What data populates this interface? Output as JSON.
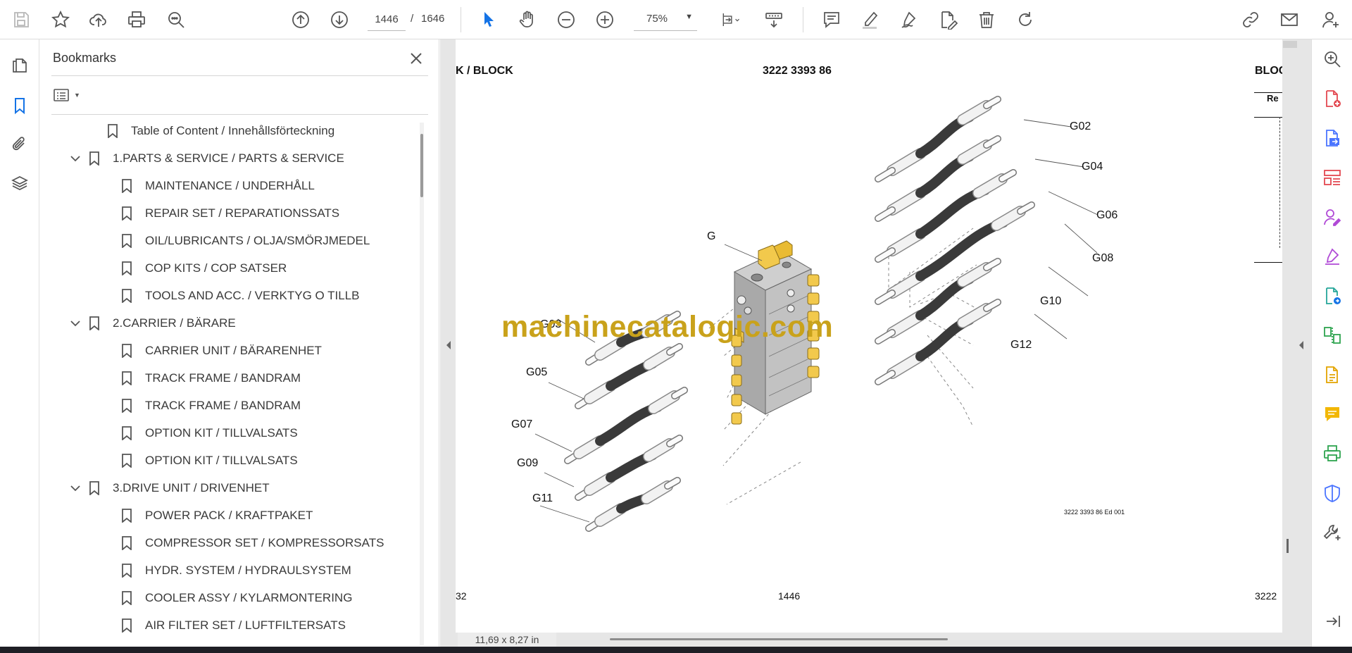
{
  "toolbar": {
    "current_page": "1446",
    "page_separator": "/",
    "total_pages": "1646",
    "zoom": "75%"
  },
  "bookmarks": {
    "title": "Bookmarks",
    "items": [
      {
        "label": "Table of Content / Innehållsförteckning",
        "level": 0,
        "expandable": false
      },
      {
        "label": "1.PARTS & SERVICE / PARTS & SERVICE",
        "level": 0,
        "expandable": true
      },
      {
        "label": "MAINTENANCE / UNDERHÅLL",
        "level": 1,
        "expandable": false
      },
      {
        "label": "REPAIR SET / REPARATIONSSATS",
        "level": 1,
        "expandable": false
      },
      {
        "label": "OIL/LUBRICANTS / OLJA/SMÖRJMEDEL",
        "level": 1,
        "expandable": false
      },
      {
        "label": "COP KITS / COP SATSER",
        "level": 1,
        "expandable": false
      },
      {
        "label": "TOOLS AND ACC. / VERKTYG O TILLB",
        "level": 1,
        "expandable": false
      },
      {
        "label": "2.CARRIER / BÄRARE",
        "level": 0,
        "expandable": true
      },
      {
        "label": "CARRIER UNIT / BÄRARENHET",
        "level": 1,
        "expandable": false
      },
      {
        "label": "TRACK FRAME / BANDRAM",
        "level": 1,
        "expandable": false
      },
      {
        "label": "TRACK FRAME / BANDRAM",
        "level": 1,
        "expandable": false
      },
      {
        "label": "OPTION KIT / TILLVALSATS",
        "level": 1,
        "expandable": false
      },
      {
        "label": "OPTION KIT / TILLVALSATS",
        "level": 1,
        "expandable": false
      },
      {
        "label": "3.DRIVE UNIT / DRIVENHET",
        "level": 0,
        "expandable": true
      },
      {
        "label": "POWER PACK / KRAFTPAKET",
        "level": 1,
        "expandable": false
      },
      {
        "label": "COMPRESSOR SET / KOMPRESSORSATS",
        "level": 1,
        "expandable": false
      },
      {
        "label": "HYDR. SYSTEM / HYDRAULSYSTEM",
        "level": 1,
        "expandable": false
      },
      {
        "label": "COOLER ASSY / KYLARMONTERING",
        "level": 1,
        "expandable": false
      },
      {
        "label": "AIR FILTER SET / LUFTFILTERSATS",
        "level": 1,
        "expandable": false
      }
    ]
  },
  "document": {
    "header_left": "K / BLOCK",
    "header_center": "3222 3393 86",
    "header_right_partial": "BLOC",
    "right_partial_small": "Re",
    "drawing_ref": "3222 3393 86 Ed 001",
    "footer_left_partial": "32",
    "footer_center": "1446",
    "footer_right_partial": "3222",
    "watermark": "machinecatalogic.com",
    "callouts": [
      {
        "id": "G"
      },
      {
        "id": "G02"
      },
      {
        "id": "G04"
      },
      {
        "id": "G06"
      },
      {
        "id": "G08"
      },
      {
        "id": "G10"
      },
      {
        "id": "G12"
      },
      {
        "id": "G03"
      },
      {
        "id": "G05"
      },
      {
        "id": "G07"
      },
      {
        "id": "G09"
      },
      {
        "id": "G11"
      }
    ]
  },
  "status": {
    "page_size": "11,69 x 8,27 in"
  },
  "colors": {
    "accent": "#1473e6",
    "brand_red": "#e34850",
    "watermark": "#c9a21b",
    "fitting_yellow": "#f2c94c",
    "hose_dark": "#3a3a3a"
  }
}
